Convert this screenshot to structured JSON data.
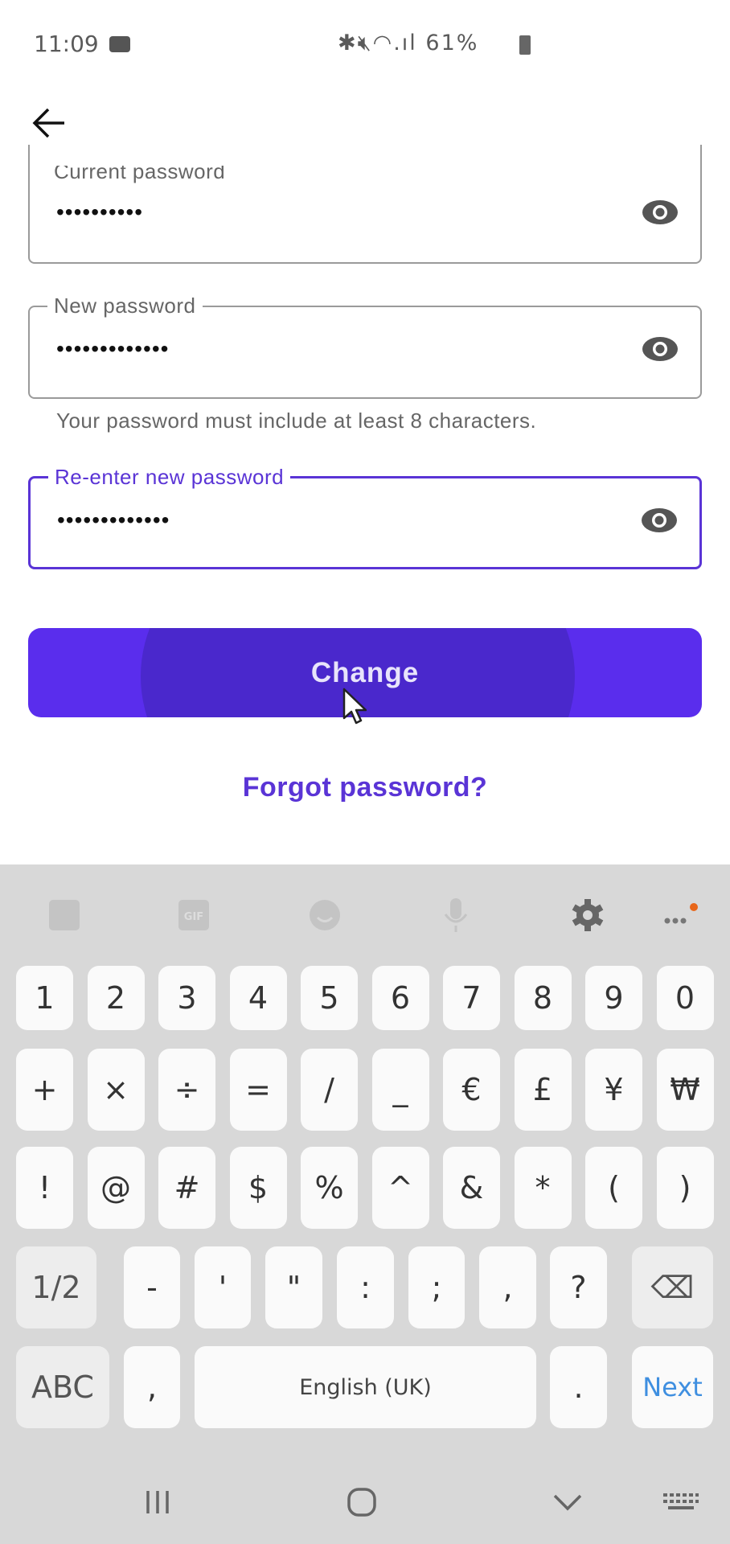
{
  "status_bar": {
    "time": "11:09",
    "battery": "61%",
    "icons": [
      "video-record-icon",
      "bluetooth-icon",
      "mute-icon",
      "wifi-icon",
      "signal-icon",
      "battery-icon"
    ]
  },
  "header": {
    "back_icon": "arrow-left-icon"
  },
  "form": {
    "current": {
      "label": "Current password",
      "value": "••••••••••"
    },
    "new": {
      "label": "New password",
      "value": "•••••••••••••",
      "helper": "Your password must include at least 8 characters."
    },
    "reenter": {
      "label": "Re-enter new password",
      "value": "•••••••••••••"
    },
    "submit_label": "Change",
    "forgot_label": "Forgot password?"
  },
  "colors": {
    "accent": "#5a2ded",
    "focus": "#5a34d6"
  },
  "keyboard": {
    "toolbar": [
      "sticker-icon",
      "gif-icon",
      "emoji-icon",
      "microphone-icon",
      "settings-icon",
      "more-icon"
    ],
    "gif_text": "GIF",
    "rows": [
      [
        "1",
        "2",
        "3",
        "4",
        "5",
        "6",
        "7",
        "8",
        "9",
        "0"
      ],
      [
        "+",
        "×",
        "÷",
        "=",
        "/",
        "_",
        "€",
        "£",
        "¥",
        "₩"
      ],
      [
        "!",
        "@",
        "#",
        "$",
        "%",
        "^",
        "&",
        "*",
        "(",
        ")"
      ],
      [
        "1/2",
        "-",
        "'",
        "\"",
        ":",
        ";",
        ",",
        "?",
        "⌫"
      ],
      [
        "ABC",
        ",",
        "English (UK)",
        ".",
        "Next"
      ]
    ]
  },
  "nav_bar": [
    "recents-icon",
    "home-icon",
    "back-chevron-icon",
    "keyboard-switch-icon"
  ]
}
